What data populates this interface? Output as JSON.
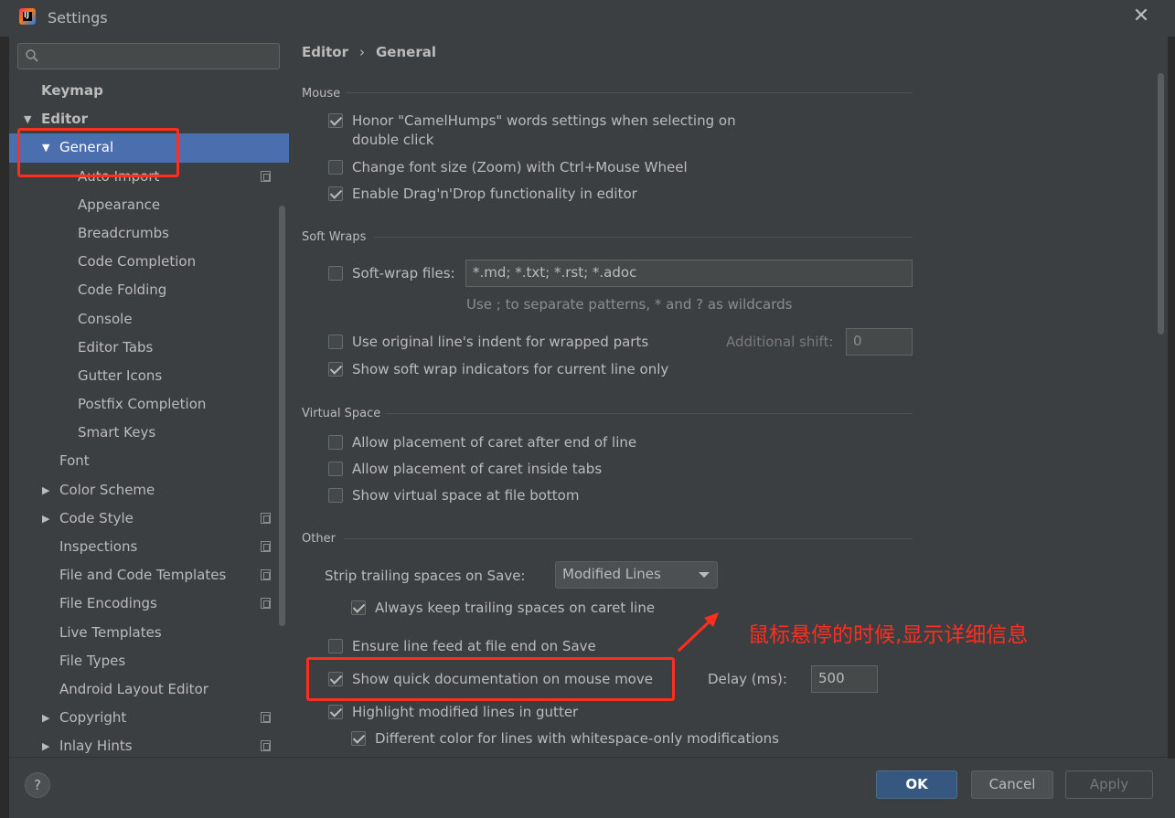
{
  "window": {
    "title": "Settings"
  },
  "sidebar": {
    "search_placeholder": "",
    "items": [
      {
        "label": "Keymap"
      },
      {
        "label": "Editor"
      },
      {
        "label": "General"
      },
      {
        "label": "Auto Import"
      },
      {
        "label": "Appearance"
      },
      {
        "label": "Breadcrumbs"
      },
      {
        "label": "Code Completion"
      },
      {
        "label": "Code Folding"
      },
      {
        "label": "Console"
      },
      {
        "label": "Editor Tabs"
      },
      {
        "label": "Gutter Icons"
      },
      {
        "label": "Postfix Completion"
      },
      {
        "label": "Smart Keys"
      },
      {
        "label": "Font"
      },
      {
        "label": "Color Scheme"
      },
      {
        "label": "Code Style"
      },
      {
        "label": "Inspections"
      },
      {
        "label": "File and Code Templates"
      },
      {
        "label": "File Encodings"
      },
      {
        "label": "Live Templates"
      },
      {
        "label": "File Types"
      },
      {
        "label": "Android Layout Editor"
      },
      {
        "label": "Copyright"
      },
      {
        "label": "Inlay Hints"
      }
    ]
  },
  "breadcrumb": {
    "parent": "Editor",
    "separator": "›",
    "current": "General"
  },
  "mouse": {
    "title": "Mouse",
    "camelhumps_line1": "Honor \"CamelHumps\" words settings when selecting on",
    "camelhumps_line2": "double click",
    "camelhumps_checked": true,
    "zoom": "Change font size (Zoom) with Ctrl+Mouse Wheel",
    "zoom_checked": false,
    "dragdrop": "Enable Drag'n'Drop functionality in editor",
    "dragdrop_checked": true
  },
  "soft_wraps": {
    "title": "Soft Wraps",
    "softwrap_label": "Soft-wrap files:",
    "softwrap_checked": false,
    "softwrap_value": "*.md; *.txt; *.rst; *.adoc",
    "hint": "Use ; to separate patterns, * and ? as wildcards",
    "indent": "Use original line's indent for wrapped parts",
    "indent_checked": false,
    "additional_shift_label": "Additional shift:",
    "additional_shift_value": "0",
    "indicators": "Show soft wrap indicators for current line only",
    "indicators_checked": true
  },
  "virtual_space": {
    "title": "Virtual Space",
    "after_eol": "Allow placement of caret after end of line",
    "inside_tabs": "Allow placement of caret inside tabs",
    "file_bottom": "Show virtual space at file bottom"
  },
  "other": {
    "title": "Other",
    "strip_label": "Strip trailing spaces on Save:",
    "strip_value": "Modified Lines",
    "keep_trailing": "Always keep trailing spaces on caret line",
    "keep_trailing_checked": true,
    "line_feed": "Ensure line feed at file end on Save",
    "line_feed_checked": false,
    "quick_doc": "Show quick documentation on mouse move",
    "quick_doc_checked": true,
    "delay_label": "Delay (ms):",
    "delay_value": "500",
    "highlight_modified": "Highlight modified lines in gutter",
    "highlight_modified_checked": true,
    "whitespace_color": "Different color for lines with whitespace-only modifications",
    "whitespace_color_checked": true
  },
  "annotation": {
    "text": "鼠标悬停的时候,显示详细信息",
    "color": "#ff2e1f"
  },
  "footer": {
    "help": "?",
    "ok": "OK",
    "cancel": "Cancel",
    "apply": "Apply"
  },
  "colors": {
    "selection": "#4b6eaf",
    "background": "#3c3f41",
    "accent_red": "#ff2e1f"
  }
}
